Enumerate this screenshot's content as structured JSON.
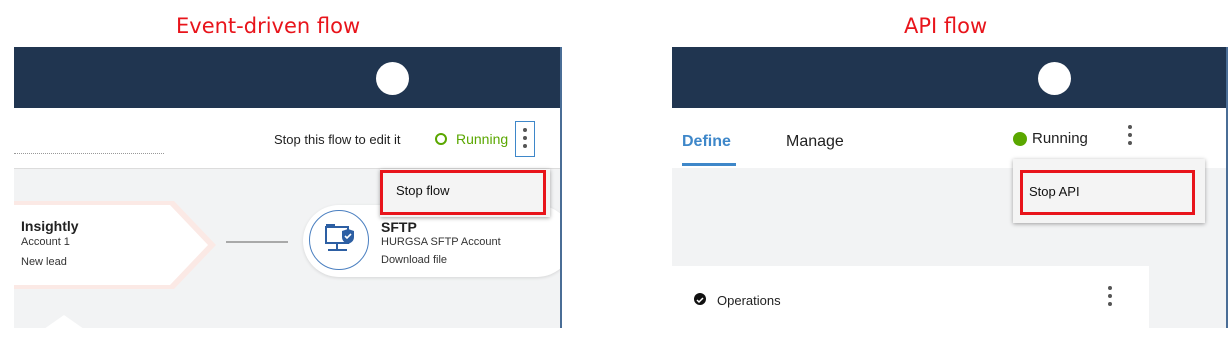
{
  "captions": {
    "left": "Event-driven flow",
    "right": "API flow"
  },
  "event_flow": {
    "edit_hint": "Stop this flow to edit it",
    "status": "Running",
    "menu": {
      "stop": "Stop flow"
    },
    "source_node": {
      "app": "Insightly",
      "account": "Account 1",
      "event": "New lead"
    },
    "target_node": {
      "app": "SFTP",
      "account": "HURGSA SFTP Account",
      "action": "Download file"
    }
  },
  "api_flow": {
    "tabs": {
      "define": "Define",
      "manage": "Manage"
    },
    "status": "Running",
    "menu": {
      "stop": "Stop API"
    },
    "operations": "Operations"
  },
  "colors": {
    "header": "#203550",
    "running_green": "#5aa700",
    "accent_blue": "#3e87c9",
    "highlight": "#e8141b"
  }
}
